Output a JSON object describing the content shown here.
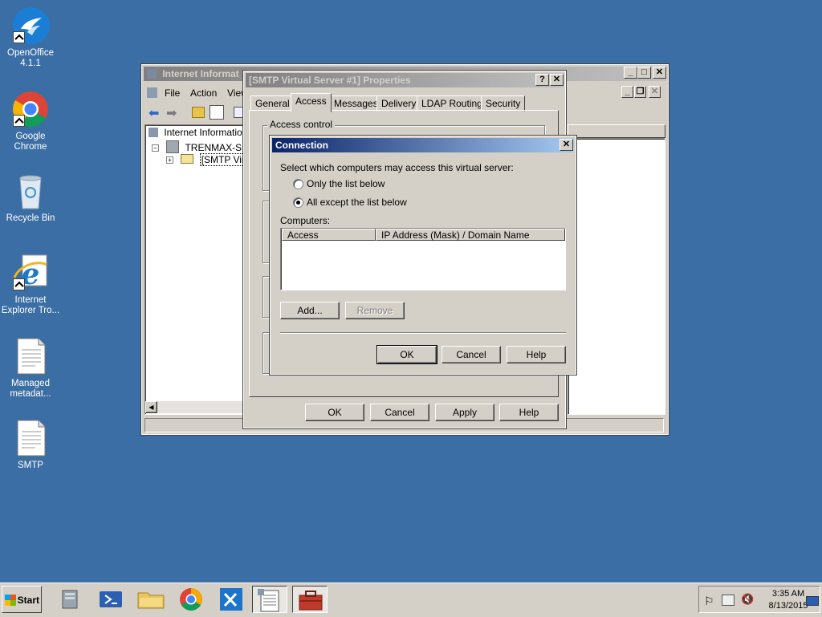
{
  "desktop": {
    "icons": [
      {
        "label": "OpenOffice\n4.1.1",
        "icon": "openoffice-icon"
      },
      {
        "label": "Google Chrome",
        "icon": "chrome-icon"
      },
      {
        "label": "Recycle Bin",
        "icon": "recycle-bin-icon"
      },
      {
        "label": "Internet\nExplorer Tro...",
        "icon": "ie-icon"
      },
      {
        "label": "Managed\nmetadat...",
        "icon": "document-icon"
      },
      {
        "label": "SMTP",
        "icon": "document-icon"
      }
    ]
  },
  "iis_window": {
    "title": "Internet Informat",
    "menu": [
      "File",
      "Action",
      "View"
    ],
    "tree": {
      "root": "Internet Information",
      "server": "TRENMAX-SP (lo",
      "site": "[SMTP Virtua"
    }
  },
  "props_dialog": {
    "title": "[SMTP Virtual Server #1] Properties",
    "tabs": [
      "General",
      "Access",
      "Messages",
      "Delivery",
      "LDAP Routing",
      "Security"
    ],
    "selected_tab": "Access",
    "group_label": "Access control",
    "buttons": {
      "ok": "OK",
      "cancel": "Cancel",
      "apply": "Apply",
      "help": "Help"
    }
  },
  "connection_dialog": {
    "title": "Connection",
    "prompt": "Select which computers may access this virtual server:",
    "radio_only": "Only the list below",
    "radio_all_except": "All except the list below",
    "selected": "all_except",
    "computers_label": "Computers:",
    "columns": [
      "Access",
      "IP Address (Mask) / Domain Name"
    ],
    "rows": [],
    "buttons": {
      "add": "Add...",
      "remove": "Remove",
      "ok": "OK",
      "cancel": "Cancel",
      "help": "Help"
    }
  },
  "taskbar": {
    "start_label": "Start",
    "clock_time": "3:35 AM",
    "clock_date": "8/13/2015"
  },
  "colors": {
    "desktop": "#3b6ea5",
    "active_title": "#0a246a",
    "face": "#d4d0c8"
  }
}
